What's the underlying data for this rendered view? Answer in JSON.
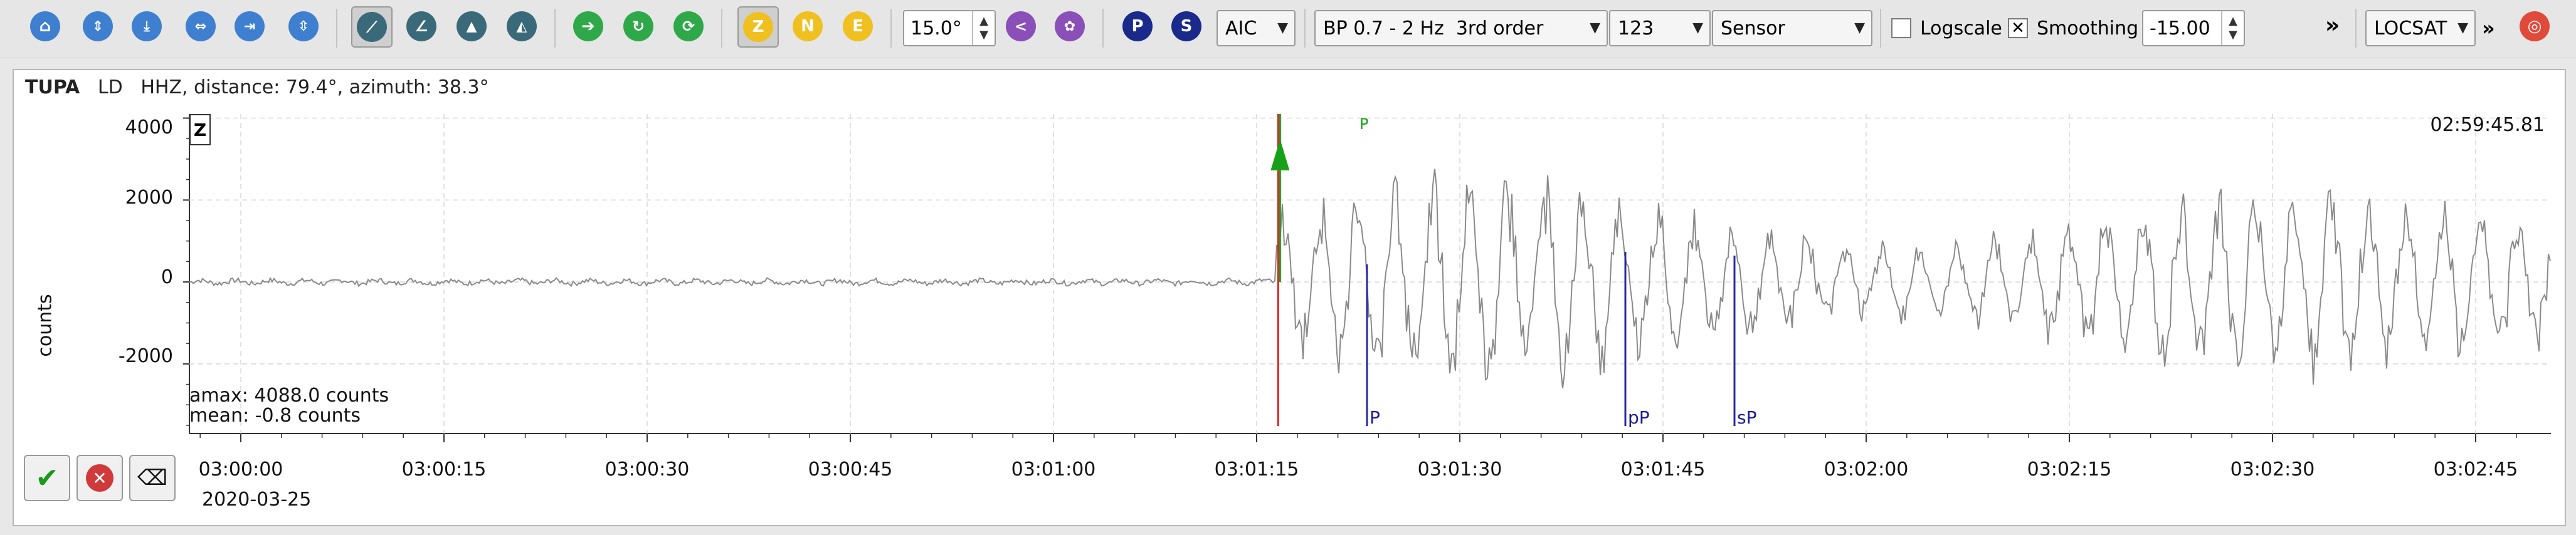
{
  "toolbar": {
    "component_buttons": [
      "Z",
      "N",
      "E"
    ],
    "pick_buttons": [
      "P",
      "S"
    ],
    "distance_value": "15.0°",
    "picker": "AIC",
    "filter": "BP 0.7 - 2 Hz  3rd order",
    "number_combo": "123",
    "units": "Sensor",
    "logscale_label": "Logscale",
    "logscale_checked": false,
    "smoothing_label": "Smoothing",
    "smoothing_checked": true,
    "offset_value": "-15.00",
    "more": "»",
    "locator": "LOCSAT",
    "more2": "»"
  },
  "trace": {
    "station": "TUPA",
    "network": "LD",
    "channel": "HHZ",
    "description": "distance: 79.4°, azimuth: 38.3°",
    "component": "Z",
    "time_right": "02:59:45.81",
    "amax": "amax: 4088.0 counts",
    "mean": "mean: -0.8 counts",
    "date": "2020-03-25",
    "picks": [
      "P",
      "pP",
      "sP"
    ],
    "marker_label": "P"
  },
  "chart_data": {
    "type": "line",
    "ylabel": "counts",
    "yticks": [
      "4000",
      "2000",
      "0",
      "-2000"
    ],
    "xticks": [
      "03:00:00",
      "03:00:15",
      "03:00:30",
      "03:00:45",
      "03:01:00",
      "03:01:15",
      "03:01:30",
      "03:01:45",
      "03:02:00",
      "03:02:15",
      "03:02:30",
      "03:02:45"
    ],
    "ylim": [
      -3700,
      4100
    ],
    "onset_index": 0.46,
    "grid": true
  },
  "colors": {
    "trace": "#8a8a8a",
    "pick": "#2a2aa0",
    "marker_red": "#e02020",
    "marker_green": "#18a018"
  }
}
